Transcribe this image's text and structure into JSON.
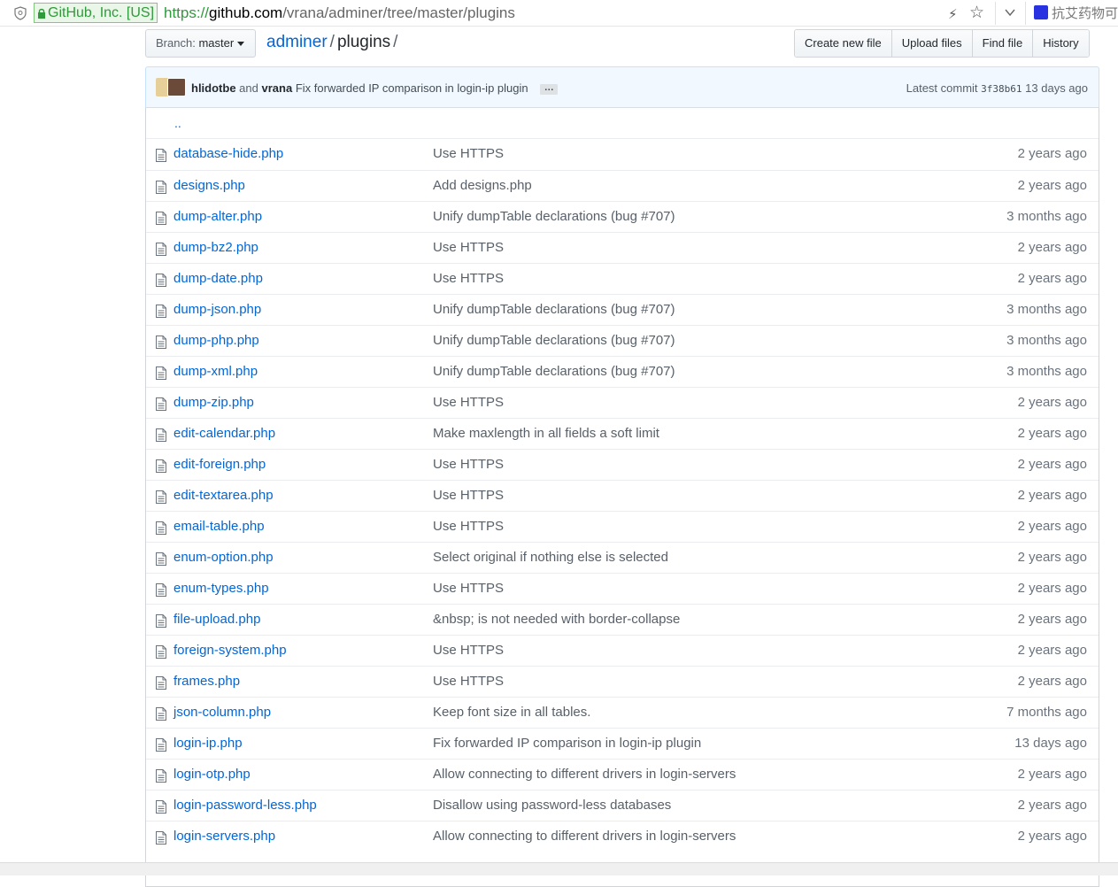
{
  "browser": {
    "cert_label": "GitHub, Inc. [US]",
    "url_scheme": "https://",
    "url_host": "github.com",
    "url_path": "/vrana/adminer/tree/master/plugins",
    "search_hint": "抗艾药物可"
  },
  "nav": {
    "branch_label": "Branch:",
    "branch_name": "master",
    "repo": "adminer",
    "sep1": "/",
    "folder": "plugins",
    "sep2": "/",
    "buttons": [
      "Create new file",
      "Upload files",
      "Find file",
      "History"
    ]
  },
  "commit": {
    "author1": "hlidotbe",
    "and": "and",
    "author2": "vrana",
    "message": "Fix forwarded IP comparison in login-ip plugin",
    "ellipsis": "…",
    "latest_label": "Latest commit",
    "sha": "3f38b61",
    "age": "13 days ago"
  },
  "up_link": "..",
  "files": [
    {
      "name": "database-hide.php",
      "message": "Use HTTPS",
      "age": "2 years ago"
    },
    {
      "name": "designs.php",
      "message": "Add designs.php",
      "age": "2 years ago"
    },
    {
      "name": "dump-alter.php",
      "message": "Unify dumpTable declarations (bug #707)",
      "age": "3 months ago"
    },
    {
      "name": "dump-bz2.php",
      "message": "Use HTTPS",
      "age": "2 years ago"
    },
    {
      "name": "dump-date.php",
      "message": "Use HTTPS",
      "age": "2 years ago"
    },
    {
      "name": "dump-json.php",
      "message": "Unify dumpTable declarations (bug #707)",
      "age": "3 months ago"
    },
    {
      "name": "dump-php.php",
      "message": "Unify dumpTable declarations (bug #707)",
      "age": "3 months ago"
    },
    {
      "name": "dump-xml.php",
      "message": "Unify dumpTable declarations (bug #707)",
      "age": "3 months ago"
    },
    {
      "name": "dump-zip.php",
      "message": "Use HTTPS",
      "age": "2 years ago"
    },
    {
      "name": "edit-calendar.php",
      "message": "Make maxlength in all fields a soft limit",
      "age": "2 years ago"
    },
    {
      "name": "edit-foreign.php",
      "message": "Use HTTPS",
      "age": "2 years ago"
    },
    {
      "name": "edit-textarea.php",
      "message": "Use HTTPS",
      "age": "2 years ago"
    },
    {
      "name": "email-table.php",
      "message": "Use HTTPS",
      "age": "2 years ago"
    },
    {
      "name": "enum-option.php",
      "message": "Select original if nothing else is selected",
      "age": "2 years ago"
    },
    {
      "name": "enum-types.php",
      "message": "Use HTTPS",
      "age": "2 years ago"
    },
    {
      "name": "file-upload.php",
      "message": "&nbsp; is not needed with border-collapse",
      "age": "2 years ago"
    },
    {
      "name": "foreign-system.php",
      "message": "Use HTTPS",
      "age": "2 years ago"
    },
    {
      "name": "frames.php",
      "message": "Use HTTPS",
      "age": "2 years ago"
    },
    {
      "name": "json-column.php",
      "message": "Keep font size in all tables.",
      "age": "7 months ago"
    },
    {
      "name": "login-ip.php",
      "message": "Fix forwarded IP comparison in login-ip plugin",
      "age": "13 days ago"
    },
    {
      "name": "login-otp.php",
      "message": "Allow connecting to different drivers in login-servers",
      "age": "2 years ago"
    },
    {
      "name": "login-password-less.php",
      "message": "Disallow using password-less databases",
      "age": "2 years ago"
    },
    {
      "name": "login-servers.php",
      "message": "Allow connecting to different drivers in login-servers",
      "age": "2 years ago"
    }
  ]
}
